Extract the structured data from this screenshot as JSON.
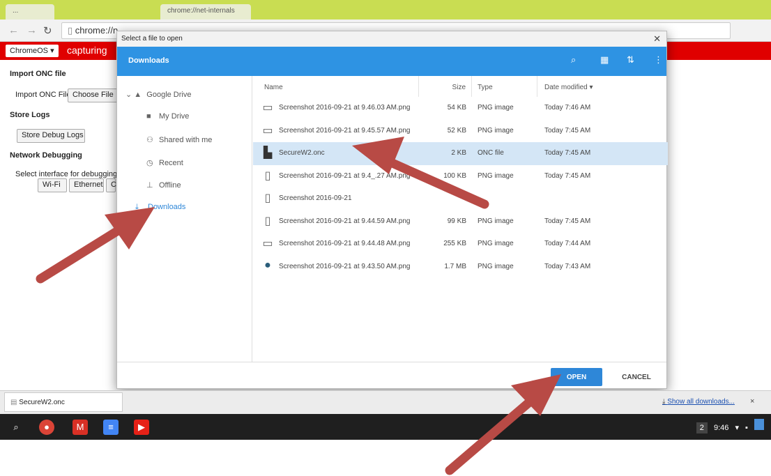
{
  "browser": {
    "tab1_label": "...",
    "tab2_label": "chrome://net-internals",
    "address": "chrome://n"
  },
  "capture_bar": {
    "chromeos_label": "ChromeOS ▾",
    "capturing_text": "capturing"
  },
  "page": {
    "import_title": "Import ONC file",
    "import_label": "Import ONC File",
    "choose_file": "Choose File",
    "store_title": "Store Logs",
    "store_button": "Store Debug Logs",
    "network_title": "Network Debugging",
    "select_interface": "Select interface for debugging",
    "wifi": "Wi-Fi",
    "ethernet": "Ethernet",
    "cellular": "C"
  },
  "dialog": {
    "window_title": "Select a file to open",
    "header_title": "Downloads",
    "nav": [
      {
        "label": "Google Drive",
        "icon": "drive-icon"
      },
      {
        "label": "My Drive",
        "icon": "folder-icon"
      },
      {
        "label": "Shared with me",
        "icon": "people-icon"
      },
      {
        "label": "Recent",
        "icon": "clock-icon"
      },
      {
        "label": "Offline",
        "icon": "pin-icon"
      },
      {
        "label": "Downloads",
        "icon": "download-icon"
      }
    ],
    "columns": {
      "name": "Name",
      "size": "Size",
      "type": "Type",
      "date": "Date modified ▾"
    },
    "files": [
      {
        "name": "Screenshot 2016-09-21 at 9.46.03 AM.png",
        "size": "54 KB",
        "type": "PNG image",
        "date": "Today 7:46 AM"
      },
      {
        "name": "Screenshot 2016-09-21 at 9.45.57 AM.png",
        "size": "52 KB",
        "type": "PNG image",
        "date": "Today 7:45 AM"
      },
      {
        "name": "SecureW2.onc",
        "size": "2 KB",
        "type": "ONC file",
        "date": "Today 7:45 AM"
      },
      {
        "name": "Screenshot 2016-09-21 at 9.4_.27 AM.png",
        "size": "100 KB",
        "type": "PNG image",
        "date": "Today 7:45 AM"
      },
      {
        "name": "Screenshot 2016-09-21",
        "size": "",
        "type": "",
        "date": ""
      },
      {
        "name": "Screenshot 2016-09-21 at 9.44.59 AM.png",
        "size": "99 KB",
        "type": "PNG image",
        "date": "Today 7:45 AM"
      },
      {
        "name": "Screenshot 2016-09-21 at 9.44.48 AM.png",
        "size": "255 KB",
        "type": "PNG image",
        "date": "Today 7:44 AM"
      },
      {
        "name": "Screenshot 2016-09-21 at 9.43.50 AM.png",
        "size": "1.7 MB",
        "type": "PNG image",
        "date": "Today 7:43 AM"
      }
    ],
    "open_label": "OPEN",
    "cancel_label": "CANCEL"
  },
  "shelf": {
    "download_name": "SecureW2.onc",
    "show_all": "Show all downloads...",
    "close": "×"
  },
  "tray": {
    "notifications": "2",
    "time": "9:46"
  },
  "colors": {
    "accent": "#2e87d8",
    "header": "#2e93e3",
    "capture_bar": "#e00000",
    "arrow": "#b84a45"
  }
}
